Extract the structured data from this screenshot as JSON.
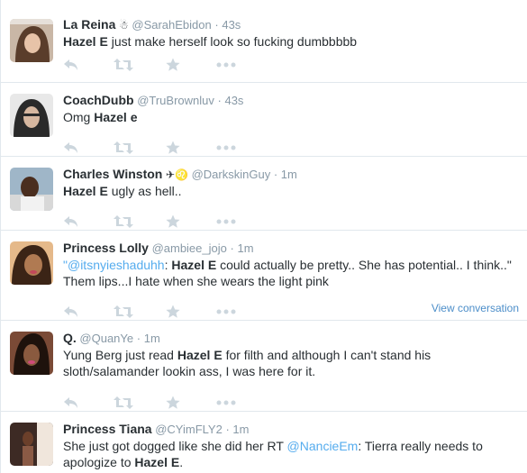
{
  "tweets": [
    {
      "fullname": "La Reina",
      "emoji": "☃",
      "username": "@SarahEbidon",
      "sep": "·",
      "time": "43s",
      "text": [
        {
          "t": "Hazel E",
          "b": true
        },
        {
          "t": " just make herself look so fucking dumbbbbb"
        }
      ]
    },
    {
      "fullname": "CoachDubb",
      "emoji": "",
      "username": "@TruBrownluv",
      "sep": "·",
      "time": "43s",
      "text": [
        {
          "t": "Omg "
        },
        {
          "t": "Hazel e",
          "b": true
        }
      ]
    },
    {
      "fullname": "Charles Winston",
      "emoji": "✈♌",
      "username": "@DarkskinGuy",
      "sep": "·",
      "time": "1m",
      "text": [
        {
          "t": "Hazel E",
          "b": true
        },
        {
          "t": " ugly as hell.."
        }
      ]
    },
    {
      "fullname": "Princess Lolly",
      "emoji": "",
      "username": "@ambiee_jojo",
      "sep": "·",
      "time": "1m",
      "text": [
        {
          "t": "\"",
          "m": true
        },
        {
          "t": "@itsnyieshaduhh",
          "m": true
        },
        {
          "t": ": "
        },
        {
          "t": "Hazel E",
          "b": true
        },
        {
          "t": " could actually be pretty.. She has potential.. I think..\" Them lips...I hate when she wears the light pink"
        }
      ],
      "view_conversation": "View conversation"
    },
    {
      "fullname": "Q.",
      "emoji": "",
      "username": "@QuanYe",
      "sep": "·",
      "time": "1m",
      "text": [
        {
          "t": "Yung Berg just read "
        },
        {
          "t": "Hazel E",
          "b": true
        },
        {
          "t": " for filth and although I can't stand his sloth/salamander lookin ass, I was here for it."
        }
      ]
    },
    {
      "fullname": "Princess Tiana",
      "emoji": "",
      "username": "@CYimFLY2",
      "sep": "·",
      "time": "1m",
      "text": [
        {
          "t": "She just got dogged like she did her  RT "
        },
        {
          "t": "@NancieEm",
          "m": true
        },
        {
          "t": ": Tierra really needs to apologize to "
        },
        {
          "t": "Hazel E",
          "b": true
        },
        {
          "t": "."
        }
      ]
    }
  ],
  "icons": {
    "reply": "reply-icon",
    "retweet": "retweet-icon",
    "favorite": "star-icon",
    "more": "more-icon"
  },
  "colors": {
    "action_icon": "#ccd6dd",
    "muted": "#8899a6",
    "link": "#55acee",
    "border": "#e1e8ed"
  }
}
